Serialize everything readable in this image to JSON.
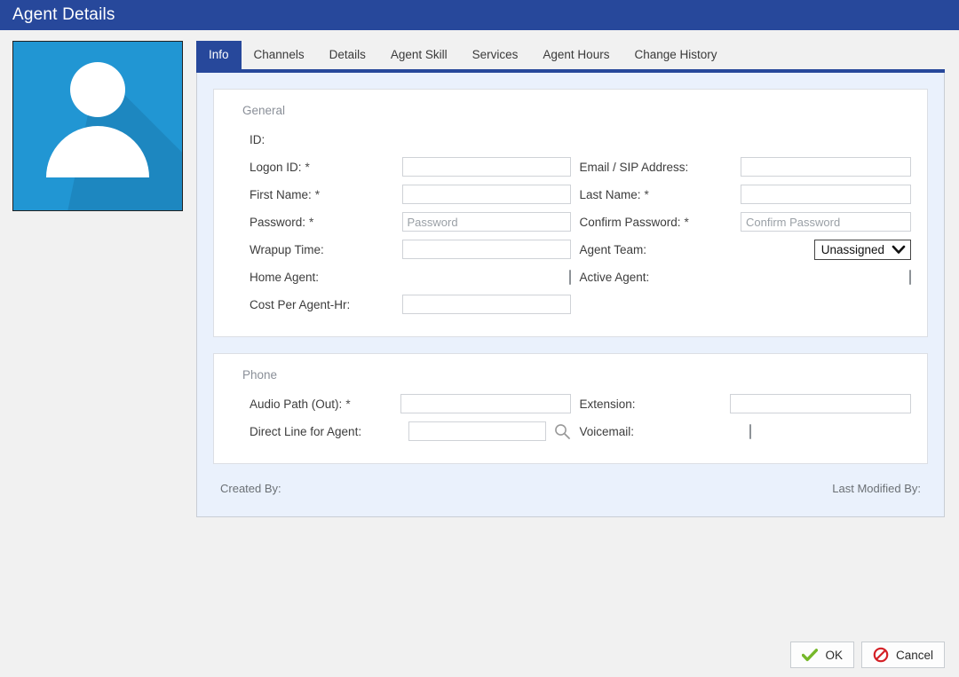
{
  "window": {
    "title": "Agent Details"
  },
  "avatar": {
    "icon": "user-avatar-icon"
  },
  "tabs": [
    {
      "label": "Info",
      "active": true
    },
    {
      "label": "Channels",
      "active": false
    },
    {
      "label": "Details",
      "active": false
    },
    {
      "label": "Agent Skill",
      "active": false
    },
    {
      "label": "Services",
      "active": false
    },
    {
      "label": "Agent Hours",
      "active": false
    },
    {
      "label": "Change History",
      "active": false
    }
  ],
  "general": {
    "title": "General",
    "id_label": "ID:",
    "id_value": "",
    "left": {
      "logon_id_label": "Logon ID:",
      "logon_id_required": "*",
      "logon_id_value": "",
      "first_name_label": "First Name:",
      "first_name_required": "*",
      "first_name_value": "",
      "password_label": "Password:",
      "password_required": "*",
      "password_value": "",
      "password_placeholder": "Password",
      "wrapup_time_label": "Wrapup Time:",
      "wrapup_time_value": "",
      "home_agent_label": "Home Agent:",
      "home_agent_checked": false,
      "cost_per_agent_hr_label": "Cost Per Agent-Hr:",
      "cost_per_agent_hr_value": ""
    },
    "right": {
      "email_sip_label": "Email / SIP Address:",
      "email_sip_value": "",
      "last_name_label": "Last Name:",
      "last_name_required": "*",
      "last_name_value": "",
      "confirm_password_label": "Confirm Password:",
      "confirm_password_required": "*",
      "confirm_password_value": "",
      "confirm_password_placeholder": "Confirm Password",
      "agent_team_label": "Agent Team:",
      "agent_team_selected": "Unassigned",
      "agent_team_icon": "chevron-down-icon",
      "active_agent_label": "Active Agent:",
      "active_agent_checked": false
    }
  },
  "phone": {
    "title": "Phone",
    "left": {
      "audio_path_label": "Audio Path (Out):",
      "audio_path_required": "*",
      "audio_path_value": "",
      "direct_line_label": "Direct Line for Agent:",
      "direct_line_value": "",
      "direct_line_search_icon": "search-icon"
    },
    "right": {
      "extension_label": "Extension:",
      "extension_value": "",
      "voicemail_label": "Voicemail:",
      "voicemail_checked": false
    }
  },
  "panel_footer": {
    "created_by": "Created By:",
    "last_modified_by": "Last Modified By:"
  },
  "actions": {
    "ok_label": "OK",
    "ok_icon": "green-check-icon",
    "cancel_label": "Cancel",
    "cancel_icon": "red-prohibited-icon"
  },
  "colors": {
    "title_bar": "#27489b",
    "active_tab": "#27489b",
    "page_background": "#f1f1f1",
    "panel_background": "#eaf1fc",
    "card_background": "#ffffff",
    "avatar_background": "#2196d3",
    "ok_icon": "#76b82a",
    "cancel_icon": "#d42026"
  }
}
